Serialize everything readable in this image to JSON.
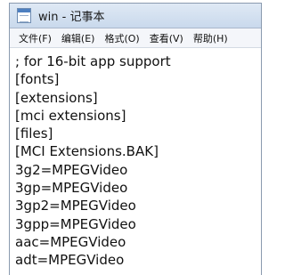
{
  "window": {
    "title": "win - 记事本"
  },
  "menu": [
    "文件(F)",
    "编辑(E)",
    "格式(O)",
    "查看(V)",
    "帮助(H)"
  ],
  "editor": {
    "lines": [
      "; for 16-bit app support",
      "[fonts]",
      "[extensions]",
      "[mci extensions]",
      "[files]",
      "[MCI Extensions.BAK]",
      "3g2=MPEGVideo",
      "3gp=MPEGVideo",
      "3gp2=MPEGVideo",
      "3gpp=MPEGVideo",
      "aac=MPEGVideo",
      "adt=MPEGVideo"
    ]
  },
  "icons": {
    "app": "notepad-icon"
  }
}
